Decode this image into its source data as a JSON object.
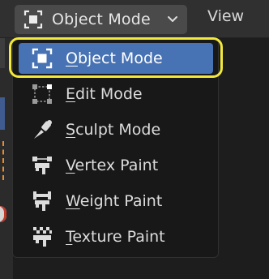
{
  "header": {
    "mode_selector_label": "Object Mode",
    "view_menu_label": "View"
  },
  "menu": {
    "items": [
      {
        "first": "O",
        "rest": "bject Mode",
        "icon": "object-mode-icon",
        "selected": true
      },
      {
        "first": "E",
        "rest": "dit Mode",
        "icon": "edit-mode-icon",
        "selected": false
      },
      {
        "first": "S",
        "rest": "culpt Mode",
        "icon": "sculpt-mode-icon",
        "selected": false
      },
      {
        "first": "V",
        "rest": "ertex Paint",
        "icon": "vertex-paint-icon",
        "selected": false
      },
      {
        "first": "W",
        "rest": "eight Paint",
        "icon": "weight-paint-icon",
        "selected": false
      },
      {
        "first": "T",
        "rest": "exture Paint",
        "icon": "texture-paint-icon",
        "selected": false
      }
    ]
  },
  "colors": {
    "accent": "#4772b3",
    "highlight_ring": "#f2e93c",
    "menu_background": "#181818",
    "header_background": "#303030"
  }
}
